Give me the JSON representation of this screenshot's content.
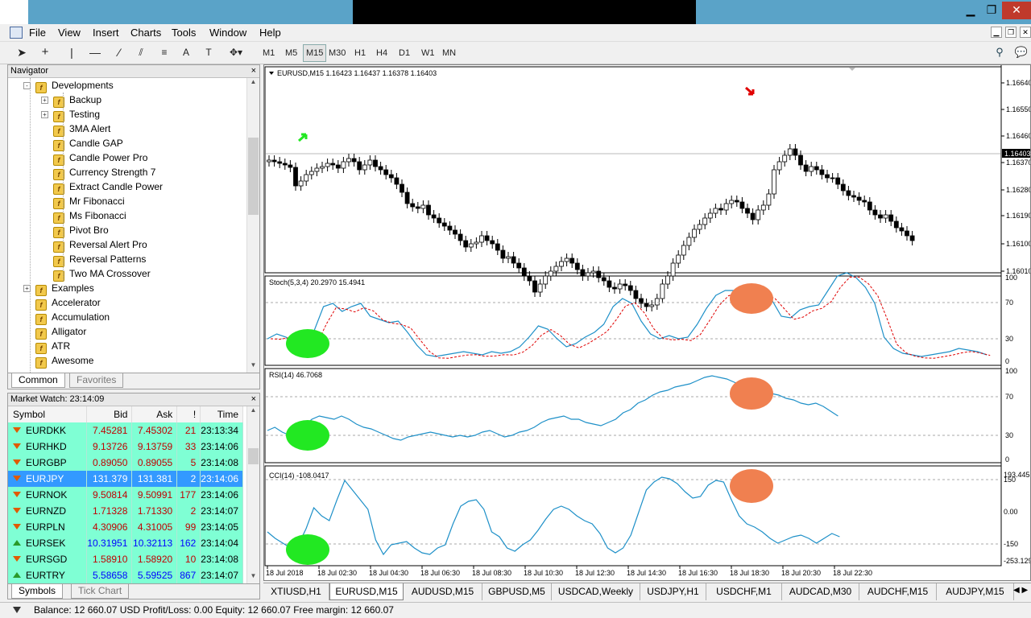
{
  "menu": [
    "File",
    "View",
    "Insert",
    "Charts",
    "Tools",
    "Window",
    "Help"
  ],
  "timeframes": [
    "M1",
    "M5",
    "M15",
    "M30",
    "H1",
    "H4",
    "D1",
    "W1",
    "MN"
  ],
  "active_timeframe": "M15",
  "navigator": {
    "title": "Navigator",
    "items": [
      {
        "label": "Developments",
        "level": 1,
        "expand": "-"
      },
      {
        "label": "Backup",
        "level": 2,
        "expand": "+"
      },
      {
        "label": "Testing",
        "level": 2,
        "expand": "+"
      },
      {
        "label": "3MA Alert",
        "level": 2
      },
      {
        "label": "Candle GAP",
        "level": 2
      },
      {
        "label": "Candle Power Pro",
        "level": 2
      },
      {
        "label": "Currency Strength 7",
        "level": 2
      },
      {
        "label": "Extract Candle Power",
        "level": 2
      },
      {
        "label": "Mr Fibonacci",
        "level": 2
      },
      {
        "label": "Ms Fibonacci",
        "level": 2
      },
      {
        "label": "Pivot Bro",
        "level": 2
      },
      {
        "label": "Reversal Alert Pro",
        "level": 2
      },
      {
        "label": "Reversal Patterns",
        "level": 2
      },
      {
        "label": "Two MA Crossover",
        "level": 2
      },
      {
        "label": "Examples",
        "level": 1,
        "expand": "+"
      },
      {
        "label": "Accelerator",
        "level": 1
      },
      {
        "label": "Accumulation",
        "level": 1
      },
      {
        "label": "Alligator",
        "level": 1
      },
      {
        "label": "ATR",
        "level": 1
      },
      {
        "label": "Awesome",
        "level": 1
      }
    ],
    "tabs": [
      "Common",
      "Favorites"
    ]
  },
  "market_watch": {
    "title": "Market Watch: 23:14:09",
    "columns": [
      "Symbol",
      "Bid",
      "Ask",
      "!",
      "Time"
    ],
    "rows": [
      {
        "symbol": "EURDKK",
        "bid": "7.45281",
        "ask": "7.45302",
        "spread": "21",
        "time": "23:13:34",
        "dir": "dn"
      },
      {
        "symbol": "EURHKD",
        "bid": "9.13726",
        "ask": "9.13759",
        "spread": "33",
        "time": "23:14:06",
        "dir": "dn"
      },
      {
        "symbol": "EURGBP",
        "bid": "0.89050",
        "ask": "0.89055",
        "spread": "5",
        "time": "23:14:08",
        "dir": "dn"
      },
      {
        "symbol": "EURJPY",
        "bid": "131.379",
        "ask": "131.381",
        "spread": "2",
        "time": "23:14:06",
        "dir": "dn",
        "selected": true
      },
      {
        "symbol": "EURNOK",
        "bid": "9.50814",
        "ask": "9.50991",
        "spread": "177",
        "time": "23:14:06",
        "dir": "dn"
      },
      {
        "symbol": "EURNZD",
        "bid": "1.71328",
        "ask": "1.71330",
        "spread": "2",
        "time": "23:14:07",
        "dir": "dn"
      },
      {
        "symbol": "EURPLN",
        "bid": "4.30906",
        "ask": "4.31005",
        "spread": "99",
        "time": "23:14:05",
        "dir": "dn"
      },
      {
        "symbol": "EURSEK",
        "bid": "10.31951",
        "ask": "10.32113",
        "spread": "162",
        "time": "23:14:04",
        "dir": "up",
        "blue": true
      },
      {
        "symbol": "EURSGD",
        "bid": "1.58910",
        "ask": "1.58920",
        "spread": "10",
        "time": "23:14:08",
        "dir": "dn"
      },
      {
        "symbol": "EURTRY",
        "bid": "5.58658",
        "ask": "5.59525",
        "spread": "867",
        "time": "23:14:07",
        "dir": "up",
        "blue": true
      }
    ],
    "tabs": [
      "Symbols",
      "Tick Chart"
    ]
  },
  "chart": {
    "header": "EURUSD,M15  1.16423 1.16437 1.16378 1.16403",
    "price_ticks": [
      "1.16640",
      "1.16550",
      "1.16460",
      "1.16370",
      "1.16280",
      "1.16190",
      "1.16100",
      "1.16010"
    ],
    "current_price": "1.16403",
    "stoch": {
      "label": "Stoch(5,3,4) 20.2970 15.4941",
      "levels": [
        "100",
        "70",
        "30",
        "0"
      ]
    },
    "rsi": {
      "label": "RSI(14) 46.7068",
      "levels": [
        "100",
        "70",
        "30",
        "0"
      ]
    },
    "cci": {
      "label": "CCI(14) -108.0417",
      "levels": [
        "193.445",
        "150",
        "0.00",
        "-150",
        "-253.129"
      ]
    },
    "time_labels": [
      "18 Jul 2018",
      "18 Jul 02:30",
      "18 Jul 04:30",
      "18 Jul 06:30",
      "18 Jul 08:30",
      "18 Jul 10:30",
      "18 Jul 12:30",
      "18 Jul 14:30",
      "18 Jul 16:30",
      "18 Jul 18:30",
      "18 Jul 20:30",
      "18 Jul 22:30"
    ],
    "colors": {
      "marker_green": "#22e822",
      "marker_orange": "#f08050",
      "indicator": "#1e90c8",
      "signal": "#e00000"
    }
  },
  "chart_tabs": [
    "XTIUSD,H1",
    "EURUSD,M15",
    "AUDUSD,M15",
    "GBPUSD,M5",
    "USDCAD,Weekly",
    "USDJPY,H1",
    "USDCHF,M1",
    "AUDCAD,M30",
    "AUDCHF,M15",
    "AUDJPY,M15"
  ],
  "active_chart_tab": "EURUSD,M15",
  "status": "Balance: 12 660.07 USD  Profit/Loss: 0.00  Equity: 12 660.07  Free margin: 12 660.07"
}
